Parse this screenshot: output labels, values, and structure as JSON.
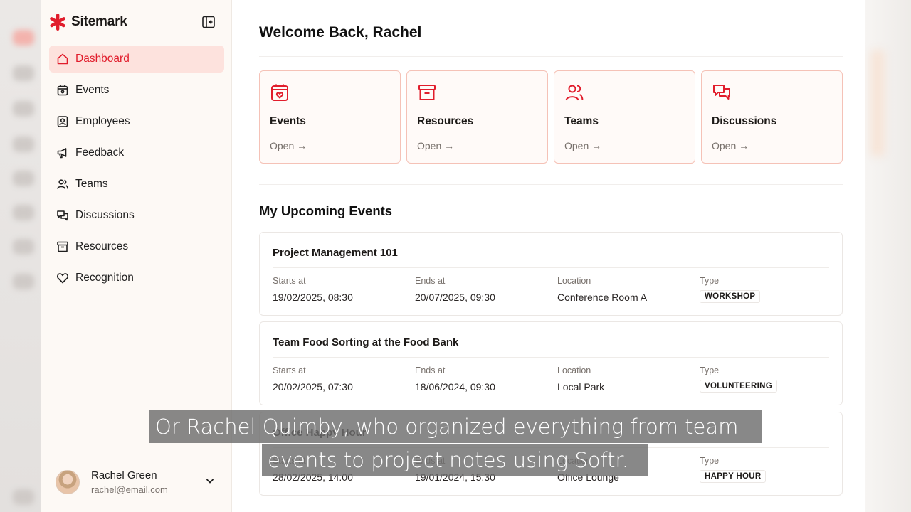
{
  "brand": {
    "name": "Sitemark",
    "accent": "#e11d2c"
  },
  "sidebar": {
    "items": [
      {
        "label": "Dashboard",
        "icon": "home-icon",
        "active": true
      },
      {
        "label": "Events",
        "icon": "calendar-icon",
        "active": false
      },
      {
        "label": "Employees",
        "icon": "id-card-icon",
        "active": false
      },
      {
        "label": "Feedback",
        "icon": "megaphone-icon",
        "active": false
      },
      {
        "label": "Teams",
        "icon": "users-icon",
        "active": false
      },
      {
        "label": "Discussions",
        "icon": "chat-icon",
        "active": false
      },
      {
        "label": "Resources",
        "icon": "archive-icon",
        "active": false
      },
      {
        "label": "Recognition",
        "icon": "heart-icon",
        "active": false
      }
    ],
    "user": {
      "name": "Rachel Green",
      "email": "rachel@email.com"
    }
  },
  "main": {
    "welcome": "Welcome Back, Rachel",
    "cards": [
      {
        "title": "Events",
        "link": "Open →",
        "icon": "calendar-heart-icon"
      },
      {
        "title": "Resources",
        "link": "Open →",
        "icon": "archive-icon"
      },
      {
        "title": "Teams",
        "link": "Open →",
        "icon": "users-icon"
      },
      {
        "title": "Discussions",
        "link": "Open →",
        "icon": "chat-icon"
      }
    ],
    "upcoming_title": "My Upcoming Events",
    "field_labels": {
      "starts": "Starts at",
      "ends": "Ends at",
      "location": "Location",
      "type": "Type"
    },
    "events": [
      {
        "title": "Project Management 101",
        "starts": "19/02/2025, 08:30",
        "ends": "20/07/2025, 09:30",
        "location": "Conference Room A",
        "type": "WORKSHOP"
      },
      {
        "title": "Team Food Sorting at the Food Bank",
        "starts": "20/02/2025, 07:30",
        "ends": "18/06/2024, 09:30",
        "location": "Local Park",
        "type": "VOLUNTEERING"
      },
      {
        "title": "Office Happy Hour",
        "starts": "28/02/2025, 14:00",
        "ends": "19/01/2024, 15:30",
        "location": "Office Lounge",
        "type": "HAPPY HOUR"
      }
    ]
  },
  "caption": {
    "line1": "Or Rachel Quimby, who organized everything from team",
    "line2": "events to project notes using Softr."
  }
}
